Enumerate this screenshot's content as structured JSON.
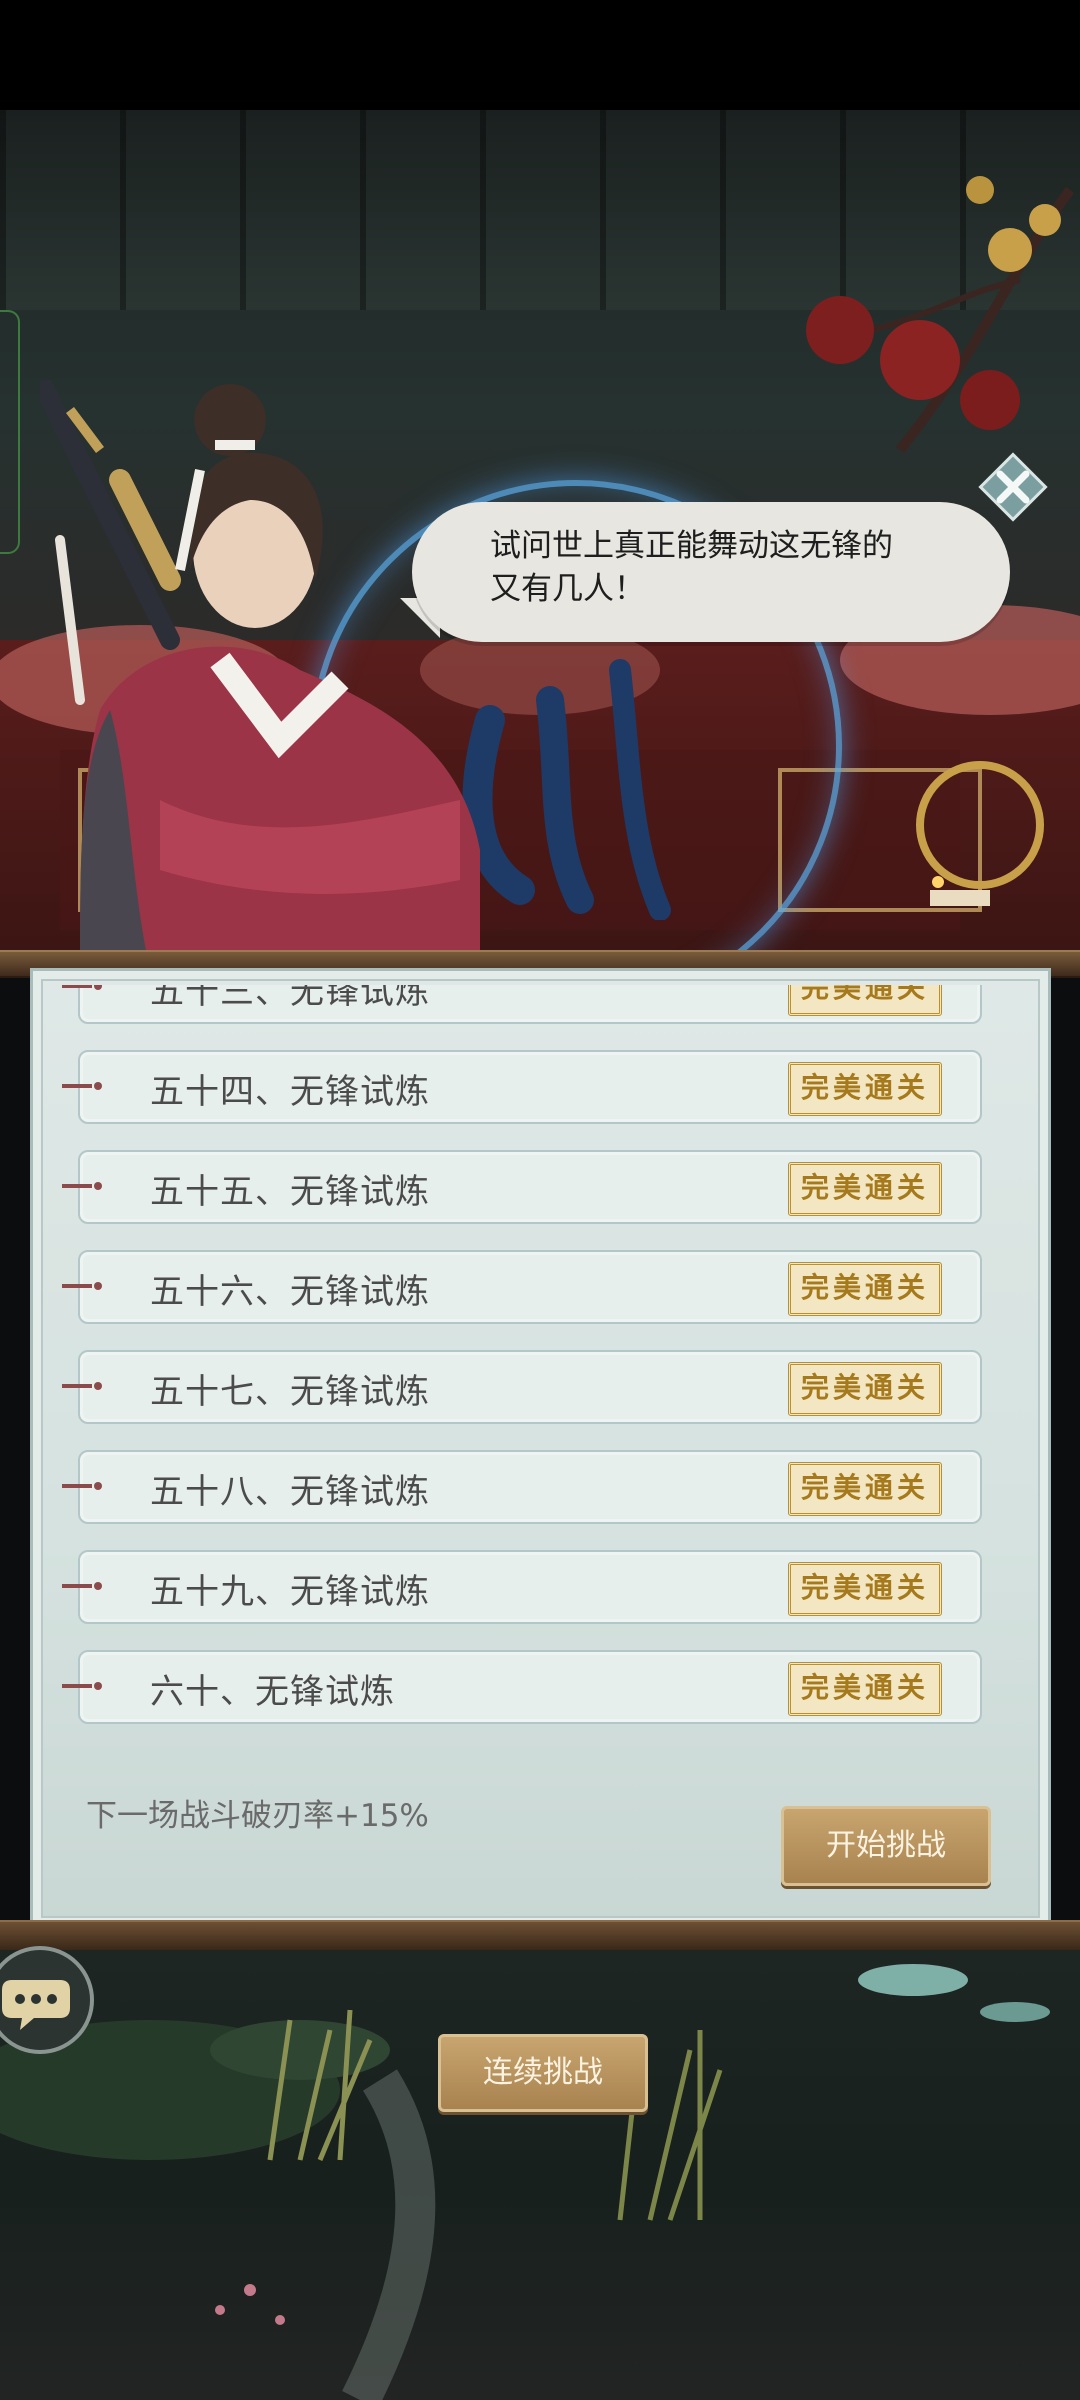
{
  "dialog": {
    "line1": "试问世上真正能舞动这无锋的",
    "line2": "又有几人！"
  },
  "levels": [
    {
      "label": "五十三、无锋试炼",
      "status": "完美通关"
    },
    {
      "label": "五十四、无锋试炼",
      "status": "完美通关"
    },
    {
      "label": "五十五、无锋试炼",
      "status": "完美通关"
    },
    {
      "label": "五十六、无锋试炼",
      "status": "完美通关"
    },
    {
      "label": "五十七、无锋试炼",
      "status": "完美通关"
    },
    {
      "label": "五十八、无锋试炼",
      "status": "完美通关"
    },
    {
      "label": "五十九、无锋试炼",
      "status": "完美通关"
    },
    {
      "label": "六十、无锋试炼",
      "status": "完美通关"
    }
  ],
  "panel": {
    "buff_text": "下一场战斗破刃率+15%",
    "start_label": "开始挑战"
  },
  "bottom": {
    "continue_label": "连续挑战"
  },
  "icons": {
    "close": "close-icon",
    "chat": "chat-bubble-icon",
    "row_pin": "scroll-pin-icon"
  },
  "colors": {
    "accent_gold": "#b8902f",
    "button_brown": "#b08b56",
    "panel_bg": "#dbe5e3"
  }
}
